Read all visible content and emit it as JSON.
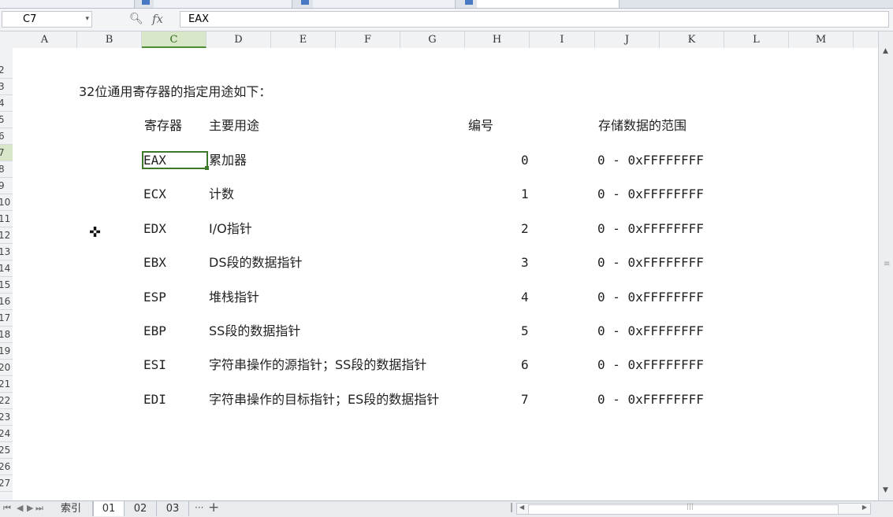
{
  "formula_bar": {
    "name_box": "C7",
    "formula": "EAX",
    "fx_label": "fx",
    "zoom_icon": "magnifier-icon"
  },
  "columns": [
    "A",
    "B",
    "C",
    "D",
    "E",
    "F",
    "G",
    "H",
    "I",
    "J",
    "K",
    "L",
    "M"
  ],
  "rows": [
    "2",
    "3",
    "4",
    "5",
    "6",
    "7",
    "8",
    "9",
    "10",
    "11",
    "12",
    "13",
    "14",
    "15",
    "16",
    "17",
    "18",
    "19",
    "20",
    "21",
    "22",
    "23",
    "24",
    "25",
    "26",
    "27"
  ],
  "selected_column": "C",
  "sheet": {
    "intro": "32位通用寄存器的指定用途如下：",
    "headers": {
      "register": "寄存器",
      "purpose": "主要用途",
      "number": "编号",
      "range": "存储数据的范围"
    },
    "registers": [
      {
        "name": "EAX",
        "purpose": "累加器",
        "number": "0",
        "range": "0 - 0xFFFFFFFF"
      },
      {
        "name": "ECX",
        "purpose": "计数",
        "number": "1",
        "range": "0 - 0xFFFFFFFF"
      },
      {
        "name": "EDX",
        "purpose": "I/O指针",
        "number": "2",
        "range": "0 - 0xFFFFFFFF"
      },
      {
        "name": "EBX",
        "purpose": "DS段的数据指针",
        "number": "3",
        "range": "0 - 0xFFFFFFFF"
      },
      {
        "name": "ESP",
        "purpose": "堆栈指针",
        "number": "4",
        "range": "0 - 0xFFFFFFFF"
      },
      {
        "name": "EBP",
        "purpose": "SS段的数据指针",
        "number": "5",
        "range": "0 - 0xFFFFFFFF"
      },
      {
        "name": "ESI",
        "purpose": "字符串操作的源指针；SS段的数据指针",
        "number": "6",
        "range": "0 - 0xFFFFFFFF"
      },
      {
        "name": "EDI",
        "purpose": "字符串操作的目标指针；ES段的数据指针",
        "number": "7",
        "range": "0 - 0xFFFFFFFF"
      }
    ]
  },
  "sheet_tabs": [
    "索引",
    "01",
    "02",
    "03"
  ],
  "active_tab": "01",
  "more_tabs": "···",
  "add_tab": "+",
  "colors": {
    "selection": "#3c7a2a",
    "selected_header": "#d8e7c7"
  }
}
